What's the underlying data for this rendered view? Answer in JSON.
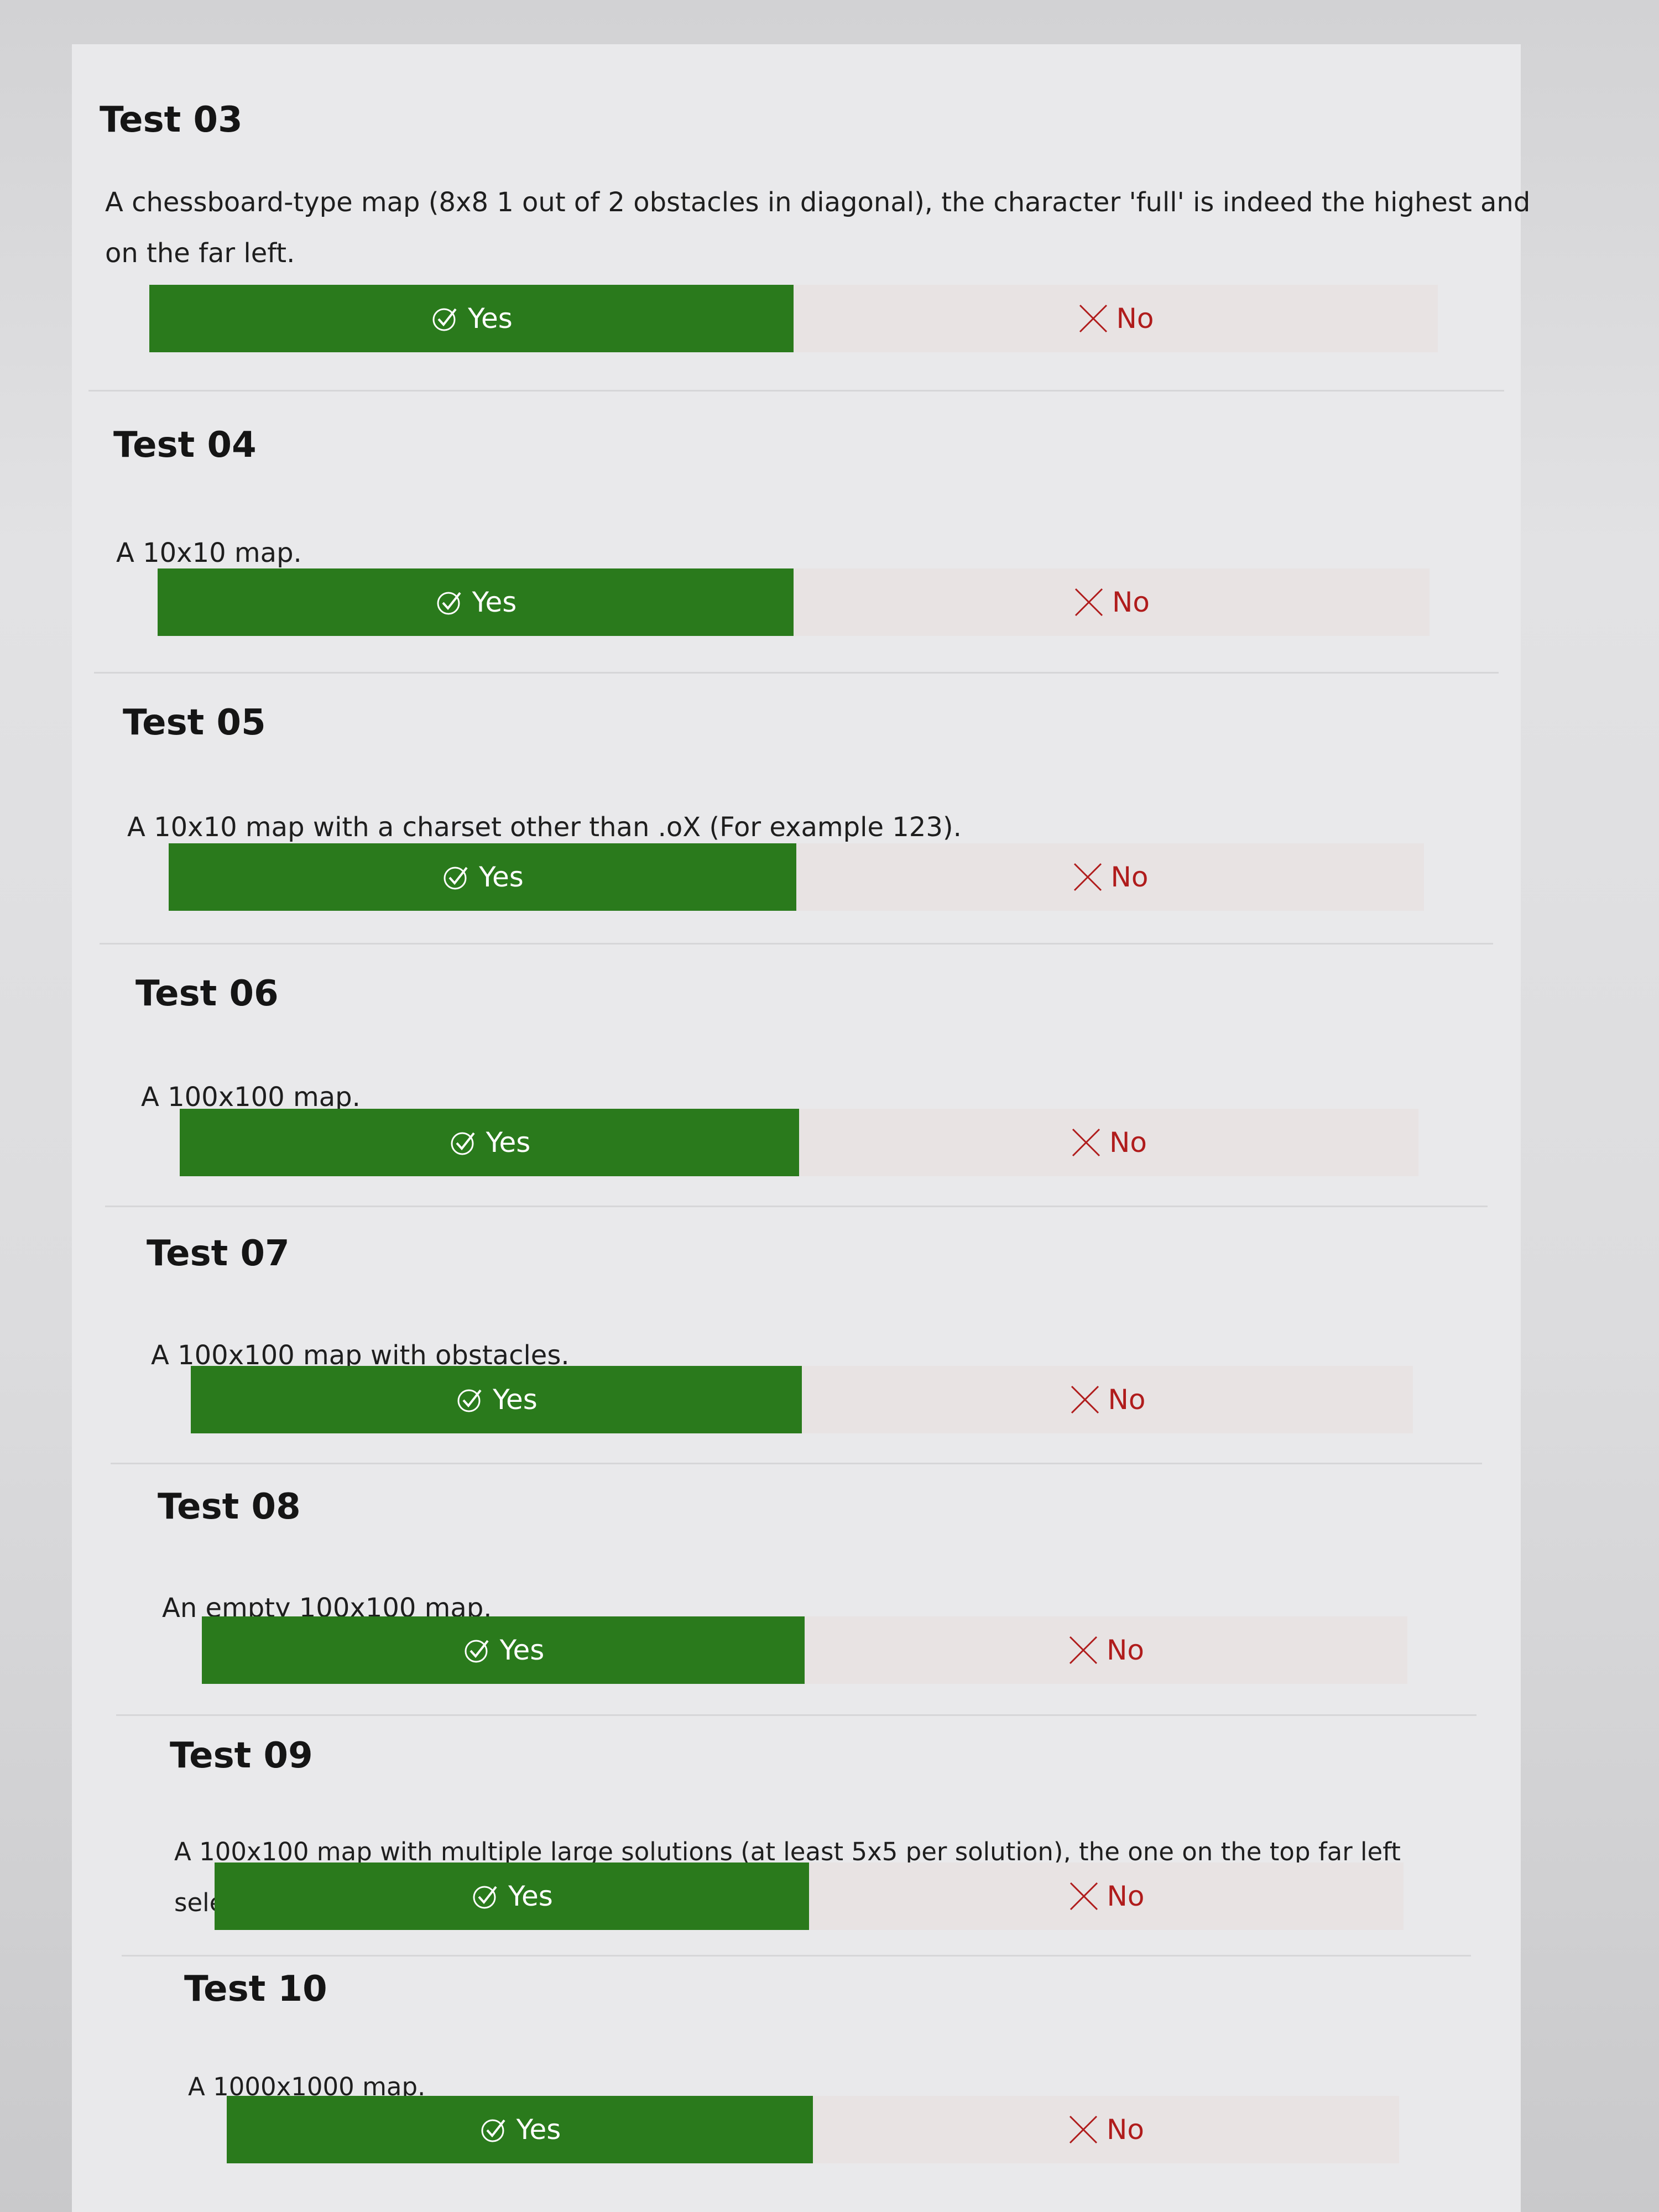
{
  "tests": [
    {
      "title": "Test 03",
      "description": "A chessboard-type map (8x8 1 out of 2 obstacles in diagonal), the character 'full' is indeed the highest and on the far left.",
      "yes_label": "Yes",
      "no_label": "No"
    },
    {
      "title": "Test 04",
      "description": "A 10x10 map.",
      "yes_label": "Yes",
      "no_label": "No"
    },
    {
      "title": "Test 05",
      "description": "A 10x10 map with a charset other than .oX (For example 123).",
      "yes_label": "Yes",
      "no_label": "No"
    },
    {
      "title": "Test 06",
      "description": "A 100x100 map.",
      "yes_label": "Yes",
      "no_label": "No"
    },
    {
      "title": "Test 07",
      "description": "A 100x100 map with obstacles.",
      "yes_label": "Yes",
      "no_label": "No"
    },
    {
      "title": "Test 08",
      "description": "An empty 100x100 map.",
      "yes_label": "Yes",
      "no_label": "No"
    },
    {
      "title": "Test 09",
      "description": "A 100x100 map with multiple large solutions (at least 5x5 per solution), the one on the top far left selected.",
      "yes_label": "Yes",
      "no_label": "No"
    },
    {
      "title": "Test 10",
      "description": "A 1000x1000 map.",
      "yes_label": "Yes",
      "no_label": "No"
    }
  ],
  "colors": {
    "yes_background": "#2a7a1c",
    "yes_text": "#ffffff",
    "no_background": "#e8e3e3",
    "no_text": "#b01c1c"
  },
  "icons": {
    "yes": "check-circle-icon",
    "no": "x-icon"
  }
}
